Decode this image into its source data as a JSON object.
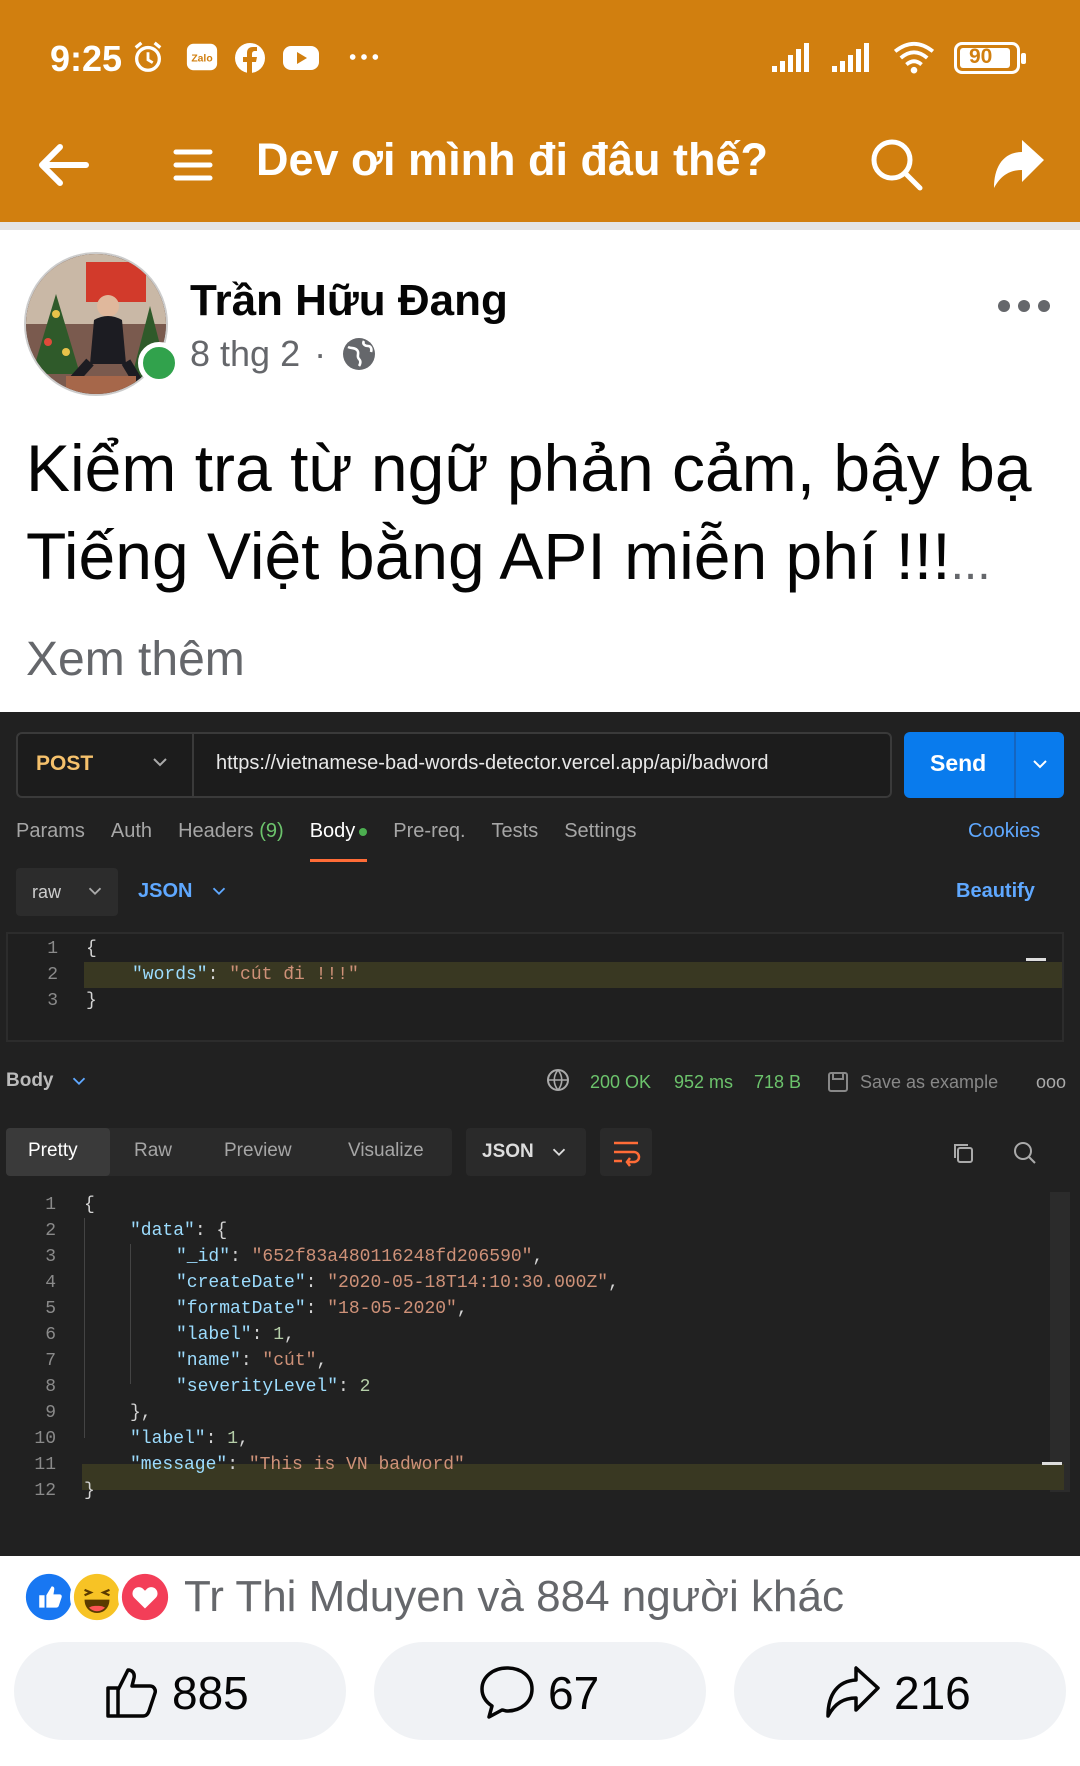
{
  "status_bar": {
    "time": "9:25",
    "battery": "90",
    "icons": [
      "alarm-icon",
      "zalo-icon",
      "facebook-icon",
      "youtube-icon",
      "more-dots-icon",
      "signal-icon",
      "signal-icon",
      "wifi-icon",
      "battery-icon"
    ]
  },
  "app_bar": {
    "title": "Dev ơi mình đi đâu thế?",
    "icons": [
      "back-arrow-icon",
      "menu-icon",
      "search-icon",
      "share-icon"
    ],
    "color": "#d17f0f"
  },
  "post": {
    "author": "Trần Hữu Đang",
    "date": "8 thg 2",
    "separator": "·",
    "text": "Kiểm tra từ ngữ phản cảm, bậy bạ Tiếng Việt bằng API miễn phí !!!",
    "see_more": "... Xem thêm"
  },
  "postman": {
    "method": "POST",
    "url": "https://vietnamese-bad-words-detector.vercel.app/api/badword",
    "send_label": "Send",
    "tabs": [
      {
        "label": "Params"
      },
      {
        "label": "Auth"
      },
      {
        "label": "Headers",
        "count": "(9)"
      },
      {
        "label": "Body"
      },
      {
        "label": "Pre-req."
      },
      {
        "label": "Tests"
      },
      {
        "label": "Settings"
      }
    ],
    "cookies_label": "Cookies",
    "body_mode": "raw",
    "body_format": "JSON",
    "beautify_label": "Beautify",
    "request_lines": [
      {
        "n": "1",
        "text": "{"
      },
      {
        "n": "2",
        "key": "\"words\"",
        "value": "\"cút đi !!!\""
      },
      {
        "n": "3",
        "text": "}"
      }
    ],
    "response_bar": {
      "label": "Body",
      "status": "200 OK",
      "time": "952 ms",
      "size": "718 B",
      "save": "Save as example",
      "more": "ooo"
    },
    "response_tabs": [
      "Pretty",
      "Raw",
      "Preview",
      "Visualize"
    ],
    "response_format": "JSON",
    "response_lines": [
      {
        "n": "1",
        "indent": 0,
        "text": "{"
      },
      {
        "n": "2",
        "indent": 1,
        "key": "\"data\"",
        "tail": ": {"
      },
      {
        "n": "3",
        "indent": 2,
        "key": "\"_id\"",
        "value": "\"652f83a480116248fd206590\"",
        "tail": ","
      },
      {
        "n": "4",
        "indent": 2,
        "key": "\"createDate\"",
        "value": "\"2020-05-18T14:10:30.000Z\"",
        "tail": ","
      },
      {
        "n": "5",
        "indent": 2,
        "key": "\"formatDate\"",
        "value": "\"18-05-2020\"",
        "tail": ","
      },
      {
        "n": "6",
        "indent": 2,
        "key": "\"label\"",
        "num": "1",
        "tail": ","
      },
      {
        "n": "7",
        "indent": 2,
        "key": "\"name\"",
        "value": "\"cút\"",
        "tail": ","
      },
      {
        "n": "8",
        "indent": 2,
        "key": "\"severityLevel\"",
        "num": "2"
      },
      {
        "n": "9",
        "indent": 1,
        "text": "},"
      },
      {
        "n": "10",
        "indent": 1,
        "key": "\"label\"",
        "num": "1",
        "tail": ","
      },
      {
        "n": "11",
        "indent": 1,
        "key": "\"message\"",
        "value": "\"This is VN badword\""
      },
      {
        "n": "12",
        "indent": 0,
        "text": "}"
      }
    ]
  },
  "reactions": {
    "icons": [
      "like-reaction-icon",
      "haha-reaction-icon",
      "love-reaction-icon"
    ],
    "text": "Tr Thi Mduyen và 884 người khác"
  },
  "actions": {
    "like_count": "885",
    "comment_count": "67",
    "share_count": "216"
  }
}
